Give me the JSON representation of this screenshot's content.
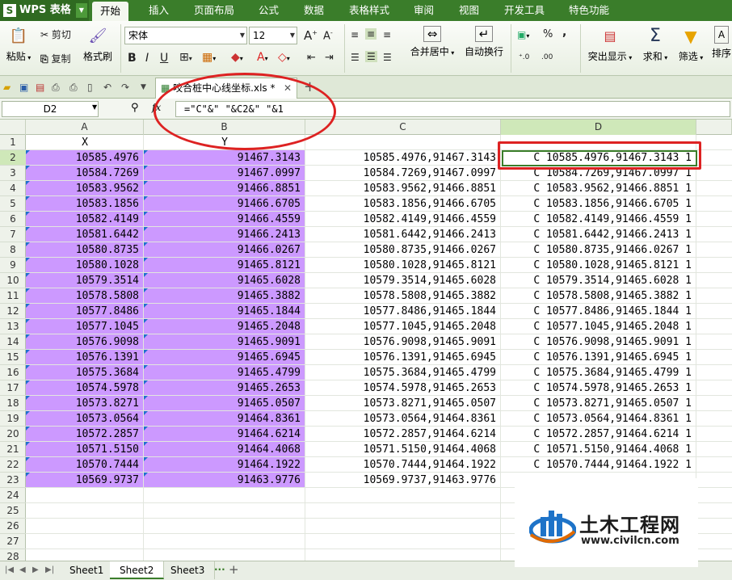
{
  "app": {
    "name": "WPS 表格",
    "logo": "S"
  },
  "menu": [
    "开始",
    "插入",
    "页面布局",
    "公式",
    "数据",
    "表格样式",
    "审阅",
    "视图",
    "开发工具",
    "特色功能"
  ],
  "ribbon": {
    "paste": "粘贴",
    "cut": "剪切",
    "copy": "复制",
    "format_painter": "格式刷",
    "font_name": "宋体",
    "font_size": "12",
    "bold": "B",
    "italic": "I",
    "underline": "U",
    "merge_center": "合并居中",
    "wrap_text": "自动换行",
    "percent": "%",
    "comma": ",",
    "highlight": "突出显示",
    "sum": "求和",
    "filter": "筛选",
    "sort": "排序"
  },
  "document": {
    "tab_title": "咬合桩中心线坐标.xls *"
  },
  "formula_bar": {
    "name_box": "D2",
    "fx": "fx",
    "formula": "=\"C\"&\" \"&C2&\" \"&1"
  },
  "columns": [
    "A",
    "B",
    "C",
    "D"
  ],
  "row_numbers": [
    "1",
    "2",
    "3",
    "4",
    "5",
    "6",
    "7",
    "8",
    "9",
    "10",
    "11",
    "12",
    "13",
    "14",
    "15",
    "16",
    "17",
    "18",
    "19",
    "20",
    "21",
    "22",
    "23",
    "24",
    "25",
    "26",
    "27",
    "28"
  ],
  "headers": {
    "x": "X",
    "y": "Y"
  },
  "rows": [
    {
      "x": "10585.4976",
      "y": "91467.3143",
      "c": "10585.4976,91467.3143",
      "d": "C 10585.4976,91467.3143 1"
    },
    {
      "x": "10584.7269",
      "y": "91467.0997",
      "c": "10584.7269,91467.0997",
      "d": "C 10584.7269,91467.0997 1"
    },
    {
      "x": "10583.9562",
      "y": "91466.8851",
      "c": "10583.9562,91466.8851",
      "d": "C 10583.9562,91466.8851 1"
    },
    {
      "x": "10583.1856",
      "y": "91466.6705",
      "c": "10583.1856,91466.6705",
      "d": "C 10583.1856,91466.6705 1"
    },
    {
      "x": "10582.4149",
      "y": "91466.4559",
      "c": "10582.4149,91466.4559",
      "d": "C 10582.4149,91466.4559 1"
    },
    {
      "x": "10581.6442",
      "y": "91466.2413",
      "c": "10581.6442,91466.2413",
      "d": "C 10581.6442,91466.2413 1"
    },
    {
      "x": "10580.8735",
      "y": "91466.0267",
      "c": "10580.8735,91466.0267",
      "d": "C 10580.8735,91466.0267 1"
    },
    {
      "x": "10580.1028",
      "y": "91465.8121",
      "c": "10580.1028,91465.8121",
      "d": "C 10580.1028,91465.8121 1"
    },
    {
      "x": "10579.3514",
      "y": "91465.6028",
      "c": "10579.3514,91465.6028",
      "d": "C 10579.3514,91465.6028 1"
    },
    {
      "x": "10578.5808",
      "y": "91465.3882",
      "c": "10578.5808,91465.3882",
      "d": "C 10578.5808,91465.3882 1"
    },
    {
      "x": "10577.8486",
      "y": "91465.1844",
      "c": "10577.8486,91465.1844",
      "d": "C 10577.8486,91465.1844 1"
    },
    {
      "x": "10577.1045",
      "y": "91465.2048",
      "c": "10577.1045,91465.2048",
      "d": "C 10577.1045,91465.2048 1"
    },
    {
      "x": "10576.9098",
      "y": "91465.9091",
      "c": "10576.9098,91465.9091",
      "d": "C 10576.9098,91465.9091 1"
    },
    {
      "x": "10576.1391",
      "y": "91465.6945",
      "c": "10576.1391,91465.6945",
      "d": "C 10576.1391,91465.6945 1"
    },
    {
      "x": "10575.3684",
      "y": "91465.4799",
      "c": "10575.3684,91465.4799",
      "d": "C 10575.3684,91465.4799 1"
    },
    {
      "x": "10574.5978",
      "y": "91465.2653",
      "c": "10574.5978,91465.2653",
      "d": "C 10574.5978,91465.2653 1"
    },
    {
      "x": "10573.8271",
      "y": "91465.0507",
      "c": "10573.8271,91465.0507",
      "d": "C 10573.8271,91465.0507 1"
    },
    {
      "x": "10573.0564",
      "y": "91464.8361",
      "c": "10573.0564,91464.8361",
      "d": "C 10573.0564,91464.8361 1"
    },
    {
      "x": "10572.2857",
      "y": "91464.6214",
      "c": "10572.2857,91464.6214",
      "d": "C 10572.2857,91464.6214 1"
    },
    {
      "x": "10571.5150",
      "y": "91464.4068",
      "c": "10571.5150,91464.4068",
      "d": "C 10571.5150,91464.4068 1"
    },
    {
      "x": "10570.7444",
      "y": "91464.1922",
      "c": "10570.7444,91464.1922",
      "d": "C 10570.7444,91464.1922 1"
    },
    {
      "x": "10569.9737",
      "y": "91463.9776",
      "c": "10569.9737,91463.9776",
      "d": ""
    }
  ],
  "sheets": [
    "Sheet1",
    "Sheet2",
    "Sheet3"
  ],
  "active_sheet": "Sheet2",
  "more_sheets": "···",
  "add_sheet": "+",
  "watermark": {
    "title": "土木工程网",
    "url": "www.civilcn.com"
  },
  "colors": {
    "menubar": "#3a7d2a",
    "purple_fill": "#cc99ff",
    "annotation_red": "#dd2222",
    "active_border": "#3a7d2a"
  }
}
